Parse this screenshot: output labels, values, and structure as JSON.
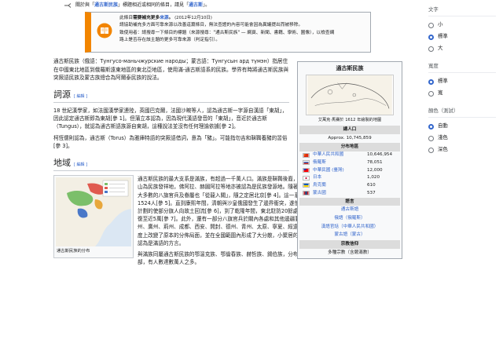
{
  "hatnote": {
    "prefix": "關於與「",
    "link1": "通古斯民族",
    "mid": "」標題相近或相同的條目，請見「",
    "link2": "通古斯",
    "suffix": "」。"
  },
  "ambox": {
    "line1_a": "此條目",
    "line1_b": "需要補充更多",
    "line1_c": "來源",
    "line1_d": "。",
    "date": "(2012年12月10日)",
    "line2": "請協助補充多方面可靠來源以改善這篇條目，無法查證的內容可能會因為異議提出而被移除。",
    "line3": "致使用者：請搜尋一下條目的標題（來源搜尋：\"通古斯民族\" — 網頁、新聞、書籍、學術、圖像），以檢查網",
    "line4": "路上是否存在該主題的更多可靠來源（判定指引）。"
  },
  "lead": {
    "p1": "通古斯民族（俄語：Тунгусо-маньчжурские народы；蒙古語：Тунгусын ард түмэн）指居住在中國東北地區到俄羅斯遠東地區的東北亞地區，使用滿-通古斯語系的民族。學界有時將通古斯民族與突厥語民族及蒙古族總合為阿爾泰民族的說法。"
  },
  "sections": {
    "etym_title": "詞源",
    "etym_edit": "[ 編輯 ]",
    "etym_p1": "18 世紀漢學家，如法國漢學家連陸，英國巴克爾，法國沙畹等人，認為通古斯一字源自漢語「東胡」，因此認定通古斯即為東胡[參 1]。但蒲立本認為，因為現代漢語發音的「東胡」，音近於通古斯（Tungus），就認為通古斯語族源自東胡，這種說法並沒有任何理論依據[參 2]。",
    "etym_p2": "柯恆儒則認為，通古斯（Torus）為雅庫特語的突厥語借詞，意為「豬」。可能指勿吉和靺鞨養豬的習俗[參 3]。",
    "region_title": "地域",
    "region_edit": "[ 編輯 ]",
    "region_p1": "通古斯民族的最大支系是滿族，有超過一千萬人口。滿族是靺鞨後裔，發源於中國東北及俄羅斯遠東，並曾遍稱長白山為民族發祥地，佛阿拉、赫圖阿拉等地亦被認為是民族發源地。隨著滿族所建立的清朝從山海關外擴張至關內，絕大多數的八旗官兵及眷屬也「從龍入關」，隨之定居北京[參 4]。這一系列舉措曾一度使留守東北的八旗兵僅剩下1524人[參 5]。直到康熙年間，清朝與沙皇俄國發生了邊界衝突，遂使得統治者重新重視東北的防務。他們開始有計劃的使部分旗人向故土回流[參 6]，到了乾隆年間，東北駐防20餘處，還有守護陵寢、圍場、邊門的旗兵總數已恢復至近5萬[參 7]。此外，還有一部分八旗官兵於關內各處和其他邊疆要塞駐防，如江寧、京口、杭州、乍浦、福州、廣州、荊州、成都、西安、開封、德州、青州、太原、寧夏、綏遠、右衛、涼州等地[參 7]。使得滿族在一定程度上改變了原本的分佈局面，並在全國範圍內形成了大分散，小聚居的特點[參 8]。另外，錫伯語通常[來源請求]被認為是滿語的方言。",
    "region_p2": "與滿族同屬通古斯民族的鄂溫克族、鄂倫春族、赫哲族、錫伯族，分布在俄羅斯西伯利亞東部、中國東北及蒙古國北部，有人數達數萬人之多。"
  },
  "thumb": {
    "caption": "通古斯民族的分布"
  },
  "infobox": {
    "title": "通古斯民族",
    "image_caption": "艾萬克·馬賽於 1612 年繪製的地圖",
    "population_header": "總人口",
    "population_total": "Approx. 10,745,859",
    "distribution_header": "分布地區",
    "regions": [
      {
        "name": "中華人民共和國",
        "value": "10,646,954",
        "flag": "cn"
      },
      {
        "name": "俄羅斯",
        "value": "78,051",
        "flag": "ru"
      },
      {
        "name": "中華民國 (臺灣)",
        "value": "12,000",
        "flag": "tw"
      },
      {
        "name": "日本",
        "value": "1,020",
        "flag": "jp"
      },
      {
        "name": "烏克蘭",
        "value": "610",
        "flag": "ua"
      },
      {
        "name": "蒙古國",
        "value": "537",
        "flag": "mn"
      }
    ],
    "language_header": "語言",
    "languages": [
      "通古斯語",
      "俄語（俄羅斯）",
      "漢語官話（中華人民共和國）",
      "蒙古語（蒙古）"
    ],
    "religion_header": "宗教信仰",
    "religion": "多種宗教（含薩滿教）"
  },
  "sidebar": {
    "text_title": "文字",
    "text_options": [
      "小",
      "標準",
      "大"
    ],
    "width_title": "寬度",
    "width_options": [
      "標準",
      "寬"
    ],
    "color_title": "顏色（測試）",
    "color_options": [
      "自動",
      "淺色",
      "深色"
    ]
  },
  "colors": {
    "link": "#3366cc",
    "notice": "#f28500",
    "red_link": "#d73333"
  }
}
